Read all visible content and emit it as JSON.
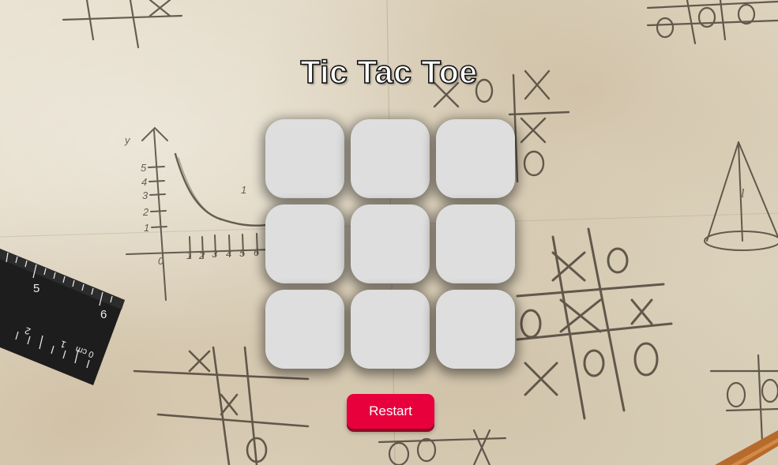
{
  "title": "Tic Tac Toe",
  "board": {
    "cells": [
      "",
      "",
      "",
      "",
      "",
      "",
      "",
      "",
      ""
    ]
  },
  "restart_label": "Restart",
  "colors": {
    "cell": "#dedede",
    "restart_button": "#e8003c",
    "title_fill": "#ffffff",
    "title_outline": "#111111"
  },
  "background": {
    "ruler_numbers": [
      "5",
      "6",
      "2",
      "1",
      "0",
      "cm"
    ],
    "graph_y_label": "y",
    "graph_y_ticks": [
      "5",
      "4",
      "3",
      "2",
      "1"
    ],
    "graph_x_ticks": [
      "0",
      "1",
      "2",
      "3",
      "4",
      "5",
      "6"
    ],
    "graph_curve_label": "1",
    "cone_label": "l"
  }
}
